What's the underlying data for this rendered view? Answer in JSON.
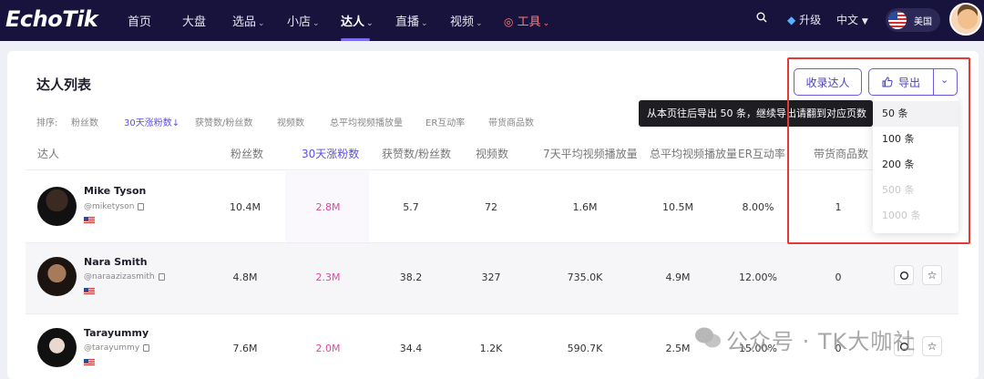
{
  "brand": {
    "logo": "EchoTik"
  },
  "nav": {
    "items": [
      {
        "label": "首页"
      },
      {
        "label": "大盘"
      },
      {
        "label": "选品"
      },
      {
        "label": "小店"
      },
      {
        "label": "达人"
      },
      {
        "label": "直播"
      },
      {
        "label": "视频"
      },
      {
        "label": "工具"
      }
    ],
    "active": "达人",
    "upgrade": "升级",
    "language": "中文",
    "region": "美国",
    "accent_color": "#7c6cf0",
    "bg_color": "#17133d"
  },
  "page": {
    "title": "达人列表",
    "collect_button": "收录达人",
    "export_button": "导出"
  },
  "sort": {
    "label": "排序:",
    "options": [
      "粉丝数",
      "30天涨粉数",
      "获赞数/粉丝数",
      "视频数",
      "总平均视频播放量",
      "ER互动率",
      "带货商品数"
    ],
    "active": "30天涨粉数"
  },
  "table": {
    "columns": [
      "达人",
      "粉丝数",
      "30天涨粉数",
      "获赞数/粉丝数",
      "视频数",
      "7天平均视频播放量",
      "总平均视频播放量",
      "ER互动率",
      "带货商品数"
    ],
    "rows": [
      {
        "name": "Mike Tyson",
        "handle": "@miketyson",
        "cells": [
          "10.4M",
          "2.8M",
          "5.7",
          "72",
          "1.6M",
          "10.5M",
          "8.00%",
          "1"
        ]
      },
      {
        "name": "Nara Smith",
        "handle": "@naraazizasmith",
        "cells": [
          "4.8M",
          "2.3M",
          "38.2",
          "327",
          "735.0K",
          "4.9M",
          "12.00%",
          "0"
        ]
      },
      {
        "name": "Tarayummy",
        "handle": "@tarayummy",
        "cells": [
          "7.6M",
          "2.0M",
          "34.4",
          "1.2K",
          "590.7K",
          "2.5M",
          "15.00%",
          "0"
        ]
      }
    ]
  },
  "tooltip": {
    "text": "从本页往后导出 50 条，继续导出请翻到对应页数"
  },
  "export_menu": {
    "options": [
      {
        "label": "50 条",
        "state": "selected"
      },
      {
        "label": "100 条",
        "state": "enabled"
      },
      {
        "label": "200 条",
        "state": "enabled"
      },
      {
        "label": "500 条",
        "state": "disabled"
      },
      {
        "label": "1000 条",
        "state": "disabled"
      }
    ]
  },
  "watermark": {
    "text": "公众号 · TK大咖社"
  },
  "colors": {
    "highlight_text": "#e04a9a",
    "primary": "#5b4ee8",
    "annotation_box": "#e53935"
  }
}
